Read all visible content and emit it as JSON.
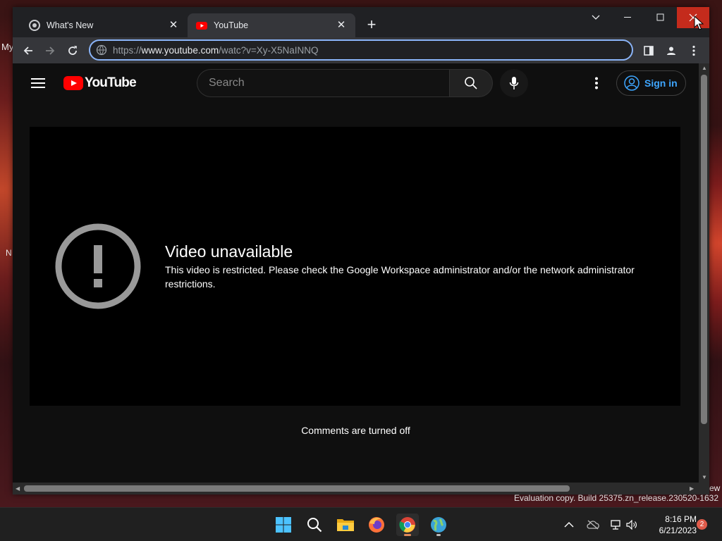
{
  "desktop": {
    "label_top": "My",
    "label_mid": "N",
    "label_right": "ew",
    "evaluation_text": "Evaluation copy. Build 25375.zn_release.230520-1632"
  },
  "browser": {
    "tabs": [
      {
        "title": "What's New",
        "icon": "chrome-icon",
        "active": false
      },
      {
        "title": "YouTube",
        "icon": "youtube-favicon",
        "active": true
      }
    ],
    "url_scheme": "https://",
    "url_host": "www.youtube.com",
    "url_path": "/watc?v=Xy-X5NaINNQ"
  },
  "youtube": {
    "logo_text": "YouTube",
    "search_placeholder": "Search",
    "signin_label": "Sign in",
    "error_title": "Video unavailable",
    "error_message": "This video is restricted. Please check the Google Workspace administrator and/or the network administrator restrictions.",
    "comments_text": "Comments are turned off"
  },
  "taskbar": {
    "apps": [
      "start-icon",
      "search-icon",
      "file-explorer-icon",
      "firefox-icon",
      "chrome-icon",
      "globe-app-icon"
    ],
    "time": "8:16 PM",
    "date": "6/21/2023",
    "notification_count": "2"
  },
  "colors": {
    "accent": "#8ab4f8",
    "youtube_red": "#ff0000",
    "signin_blue": "#3ea6ff",
    "close_red": "#c42b1c"
  }
}
